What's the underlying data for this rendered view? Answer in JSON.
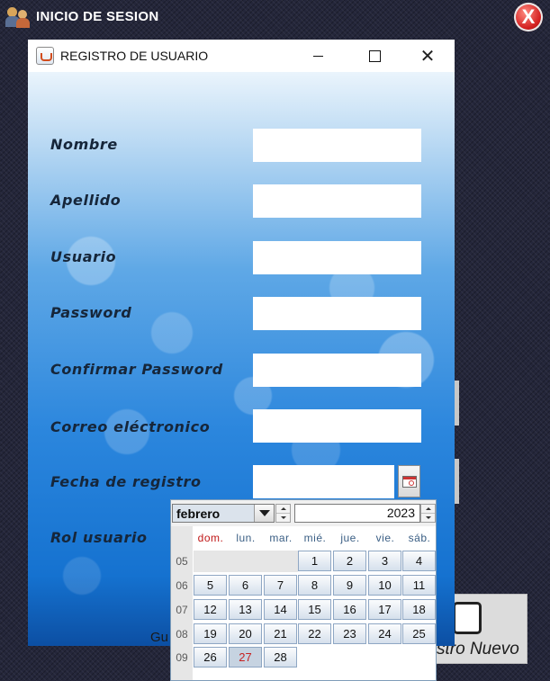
{
  "outer_window": {
    "title": "INICIO DE SESION",
    "close_glyph": "X"
  },
  "background": {
    "button_text": "stro Nuevo",
    "behind_calendar_text": "Gu"
  },
  "dialog": {
    "title": "REGISTRO DE USUARIO",
    "controls": {
      "minimize": "",
      "maximize": "",
      "close": "✕"
    },
    "fields": [
      {
        "label": "Nombre",
        "value": "",
        "placeholder": ""
      },
      {
        "label": "Apellido",
        "value": "",
        "placeholder": ""
      },
      {
        "label": "Usuario",
        "value": "",
        "placeholder": ""
      },
      {
        "label": "Password",
        "value": "",
        "placeholder": ""
      },
      {
        "label": "Confirmar Password",
        "value": "",
        "placeholder": ""
      },
      {
        "label": "Correo eléctronico",
        "value": "",
        "placeholder": ""
      },
      {
        "label": "Fecha de registro",
        "value": "",
        "placeholder": ""
      },
      {
        "label": "Rol usuario"
      }
    ]
  },
  "calendar": {
    "month": "febrero",
    "year": "2023",
    "weekday_labels": [
      "dom.",
      "lun.",
      "mar.",
      "mié.",
      "jue.",
      "vie.",
      "sáb."
    ],
    "weeks": [
      {
        "number": "05",
        "days": [
          "",
          "",
          "",
          "1",
          "2",
          "3",
          "4"
        ]
      },
      {
        "number": "06",
        "days": [
          "5",
          "6",
          "7",
          "8",
          "9",
          "10",
          "11"
        ]
      },
      {
        "number": "07",
        "days": [
          "12",
          "13",
          "14",
          "15",
          "16",
          "17",
          "18"
        ]
      },
      {
        "number": "08",
        "days": [
          "19",
          "20",
          "21",
          "22",
          "23",
          "24",
          "25"
        ]
      },
      {
        "number": "09",
        "days": [
          "26",
          "27",
          "28",
          "",
          "",
          "",
          ""
        ]
      }
    ],
    "selected_day": "27"
  },
  "colors": {
    "sunday_label": "#c01818",
    "selected_day_text": "#c62222",
    "weekday_label": "#3a5e84"
  },
  "icons": [
    "users-app-icon",
    "red-close-icon",
    "java-app-icon",
    "calendar-icon",
    "dropdown-arrow-icon",
    "spinner-icon",
    "edit-document-icon"
  ]
}
